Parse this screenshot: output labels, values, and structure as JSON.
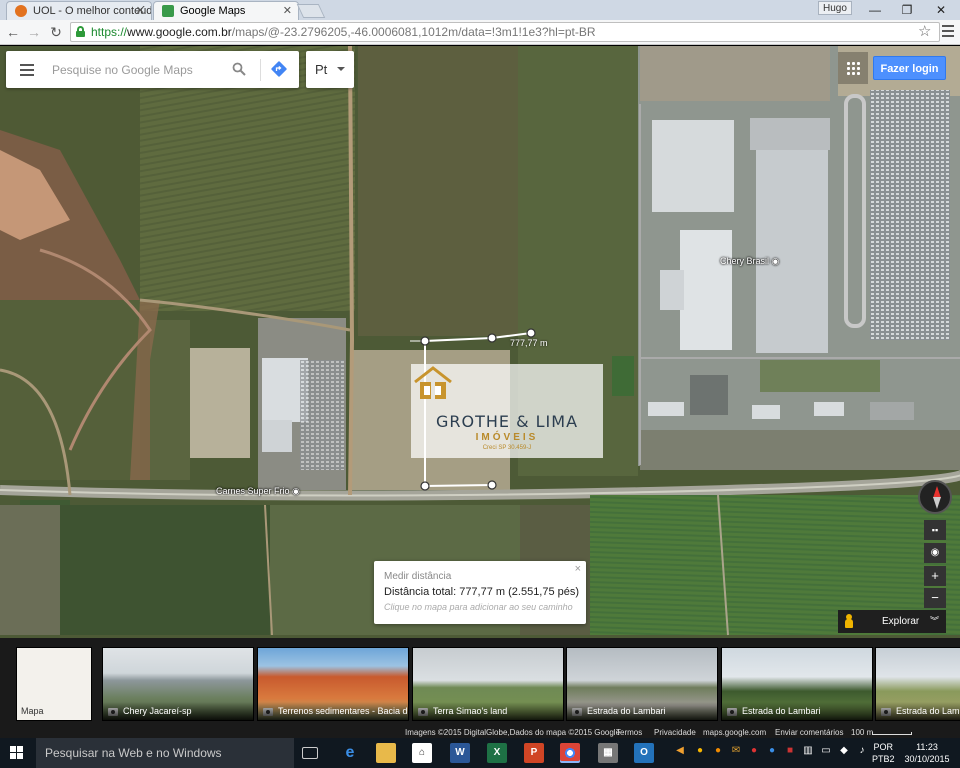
{
  "browser": {
    "tabs": [
      {
        "title": "UOL - O melhor conteúdo",
        "favicon_color": "#e2721f"
      },
      {
        "title": "Google Maps",
        "favicon_color": "#3a9a4a"
      }
    ],
    "user": "Hugo",
    "url": {
      "scheme": "https://",
      "host": "www.google.com.br",
      "path": "/maps/@-23.2796205,-46.0006081,1012m/data=!3m1!1e3?hl=pt-BR"
    },
    "window_controls": {
      "minimize": "—",
      "maximize": "❐",
      "close": "✕"
    }
  },
  "map": {
    "search_placeholder": "Pesquise no Google Maps",
    "language": "Pt",
    "login_label": "Fazer login",
    "labels": {
      "chery": "Chery Brasil",
      "carnes": "Carnes Super Frio",
      "distance": "777,77 m"
    },
    "measure": {
      "title": "Medir distância",
      "distance": "Distância total: 777,77 m (2.551,75 pés)",
      "hint": "Clique no mapa para adicionar ao seu caminho",
      "close": "×"
    },
    "controls": {
      "zoom_in": "+",
      "zoom_out": "−",
      "explore": "Explorar"
    },
    "watermark": {
      "title": "GROTHE & LIMA",
      "subtitle": "IMÓVEIS",
      "creci": "Creci SP 30.459-J"
    }
  },
  "photos": [
    {
      "label": "Mapa"
    },
    {
      "label": "Chery Jacareí-sp"
    },
    {
      "label": "Terrenos sedimentares - Bacia d..."
    },
    {
      "label": "Terra Simao's land"
    },
    {
      "label": "Estrada do Lambari"
    },
    {
      "label": "Estrada do Lambari"
    },
    {
      "label": "Estrada do Lamb"
    }
  ],
  "map_footer": {
    "imagery": "Imagens ©2015 DigitalGlobe,Dados do mapa ©2015 Google",
    "terms": "Termos",
    "privacy": "Privacidade",
    "site": "maps.google.com",
    "feedback": "Enviar comentários",
    "scale": "100 m"
  },
  "taskbar": {
    "search_placeholder": "Pesquisar na Web e no Windows",
    "lang": "POR",
    "layout": "PTB2",
    "time": "11:23",
    "date": "30/10/2015"
  }
}
